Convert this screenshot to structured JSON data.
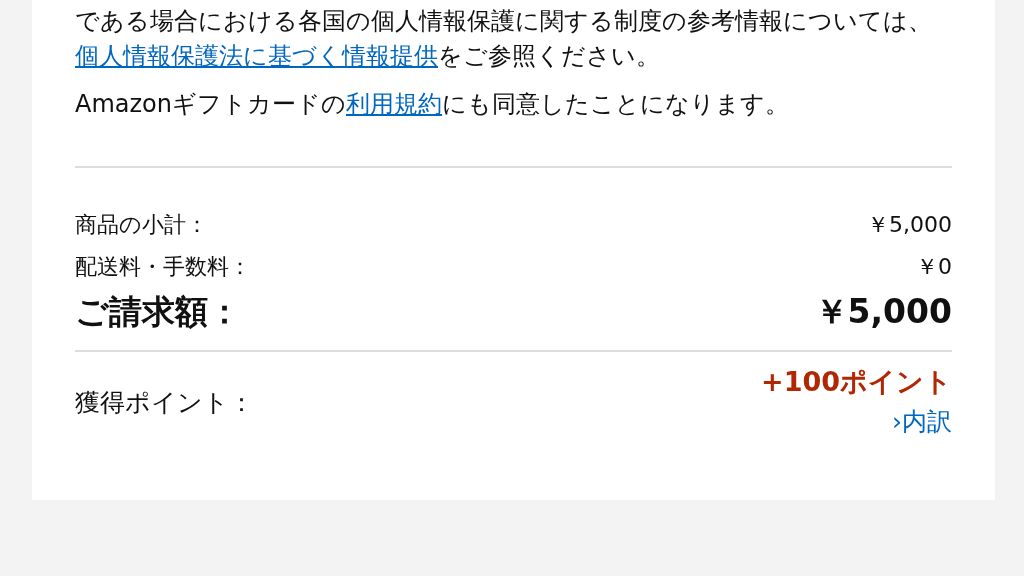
{
  "notice": [
    {
      "before": "である場合における各国の個人情報保護に関する制度の参考情報については、",
      "link": "個人情報保護法に基づく情報提供",
      "after": "をご参照ください。"
    },
    {
      "before": "Amazonギフトカードの",
      "link": "利用規約",
      "after": "にも同意したことになります。"
    }
  ],
  "summary": [
    {
      "kind": "line",
      "label": "商品の小計：",
      "value": "￥5,000"
    },
    {
      "kind": "line",
      "label": "配送料・手数料：",
      "value": "￥0"
    },
    {
      "kind": "total",
      "label": "ご請求額：",
      "value": "￥5,000"
    }
  ],
  "points": {
    "label": "獲得ポイント：",
    "value": "+100ポイント",
    "link": "›内訳"
  }
}
